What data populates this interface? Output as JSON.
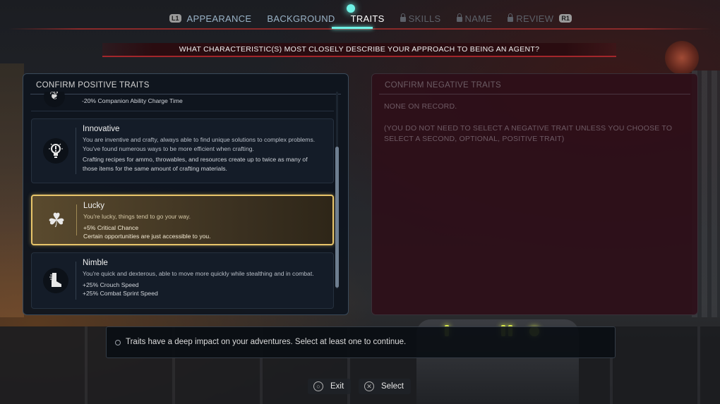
{
  "nav": {
    "left_button": "L1",
    "right_button": "R1",
    "tabs": [
      {
        "label": "APPEARANCE",
        "state": "done"
      },
      {
        "label": "BACKGROUND",
        "state": "done"
      },
      {
        "label": "TRAITS",
        "state": "active"
      },
      {
        "label": "SKILLS",
        "state": "locked"
      },
      {
        "label": "NAME",
        "state": "locked"
      },
      {
        "label": "REVIEW",
        "state": "locked"
      }
    ]
  },
  "question": "WHAT CHARACTERISTIC(S) MOST CLOSELY DESCRIBE YOUR APPROACH TO BEING AN AGENT?",
  "positive_panel": {
    "title": "CONFIRM POSITIVE TRAITS",
    "partial_trait": {
      "bonus": "-20% Companion Ability Charge Time",
      "icon": "crest-icon"
    },
    "traits": [
      {
        "name": "Innovative",
        "icon": "lightbulb-icon",
        "description": "You are inventive and crafty, always able to find unique solutions to complex problems. You've found numerous ways to be more efficient when crafting.",
        "bonus": "Crafting recipes for ammo, throwables, and resources create up to twice as many of those items for the same amount of crafting materials."
      },
      {
        "name": "Lucky",
        "icon": "clover-icon",
        "description": "You're lucky, things tend to go your way.",
        "bonus1": "+5% Critical Chance",
        "bonus2": "Certain opportunities are just accessible to you."
      },
      {
        "name": "Nimble",
        "icon": "boot-icon",
        "description": "You're quick and dexterous, able to move more quickly while stealthing and in combat.",
        "bonus1": "+25% Crouch Speed",
        "bonus2": "+25% Combat Sprint Speed"
      }
    ]
  },
  "negative_panel": {
    "title": "CONFIRM NEGATIVE TRAITS",
    "none_text": "NONE ON RECORD.",
    "note": "(YOU DO NOT NEED TO SELECT A NEGATIVE TRAIT UNLESS YOU CHOOSE TO SELECT A SECOND, OPTIONAL, POSITIVE TRAIT)"
  },
  "hint": "Traits have a deep impact on your adventures. Select at least one to continue.",
  "footer": {
    "exit_label": "Exit",
    "select_label": "Select"
  },
  "colors": {
    "accent_cyan": "#6ff3e6",
    "accent_red": "#a3262b",
    "selected_gold": "#e8c56a"
  }
}
